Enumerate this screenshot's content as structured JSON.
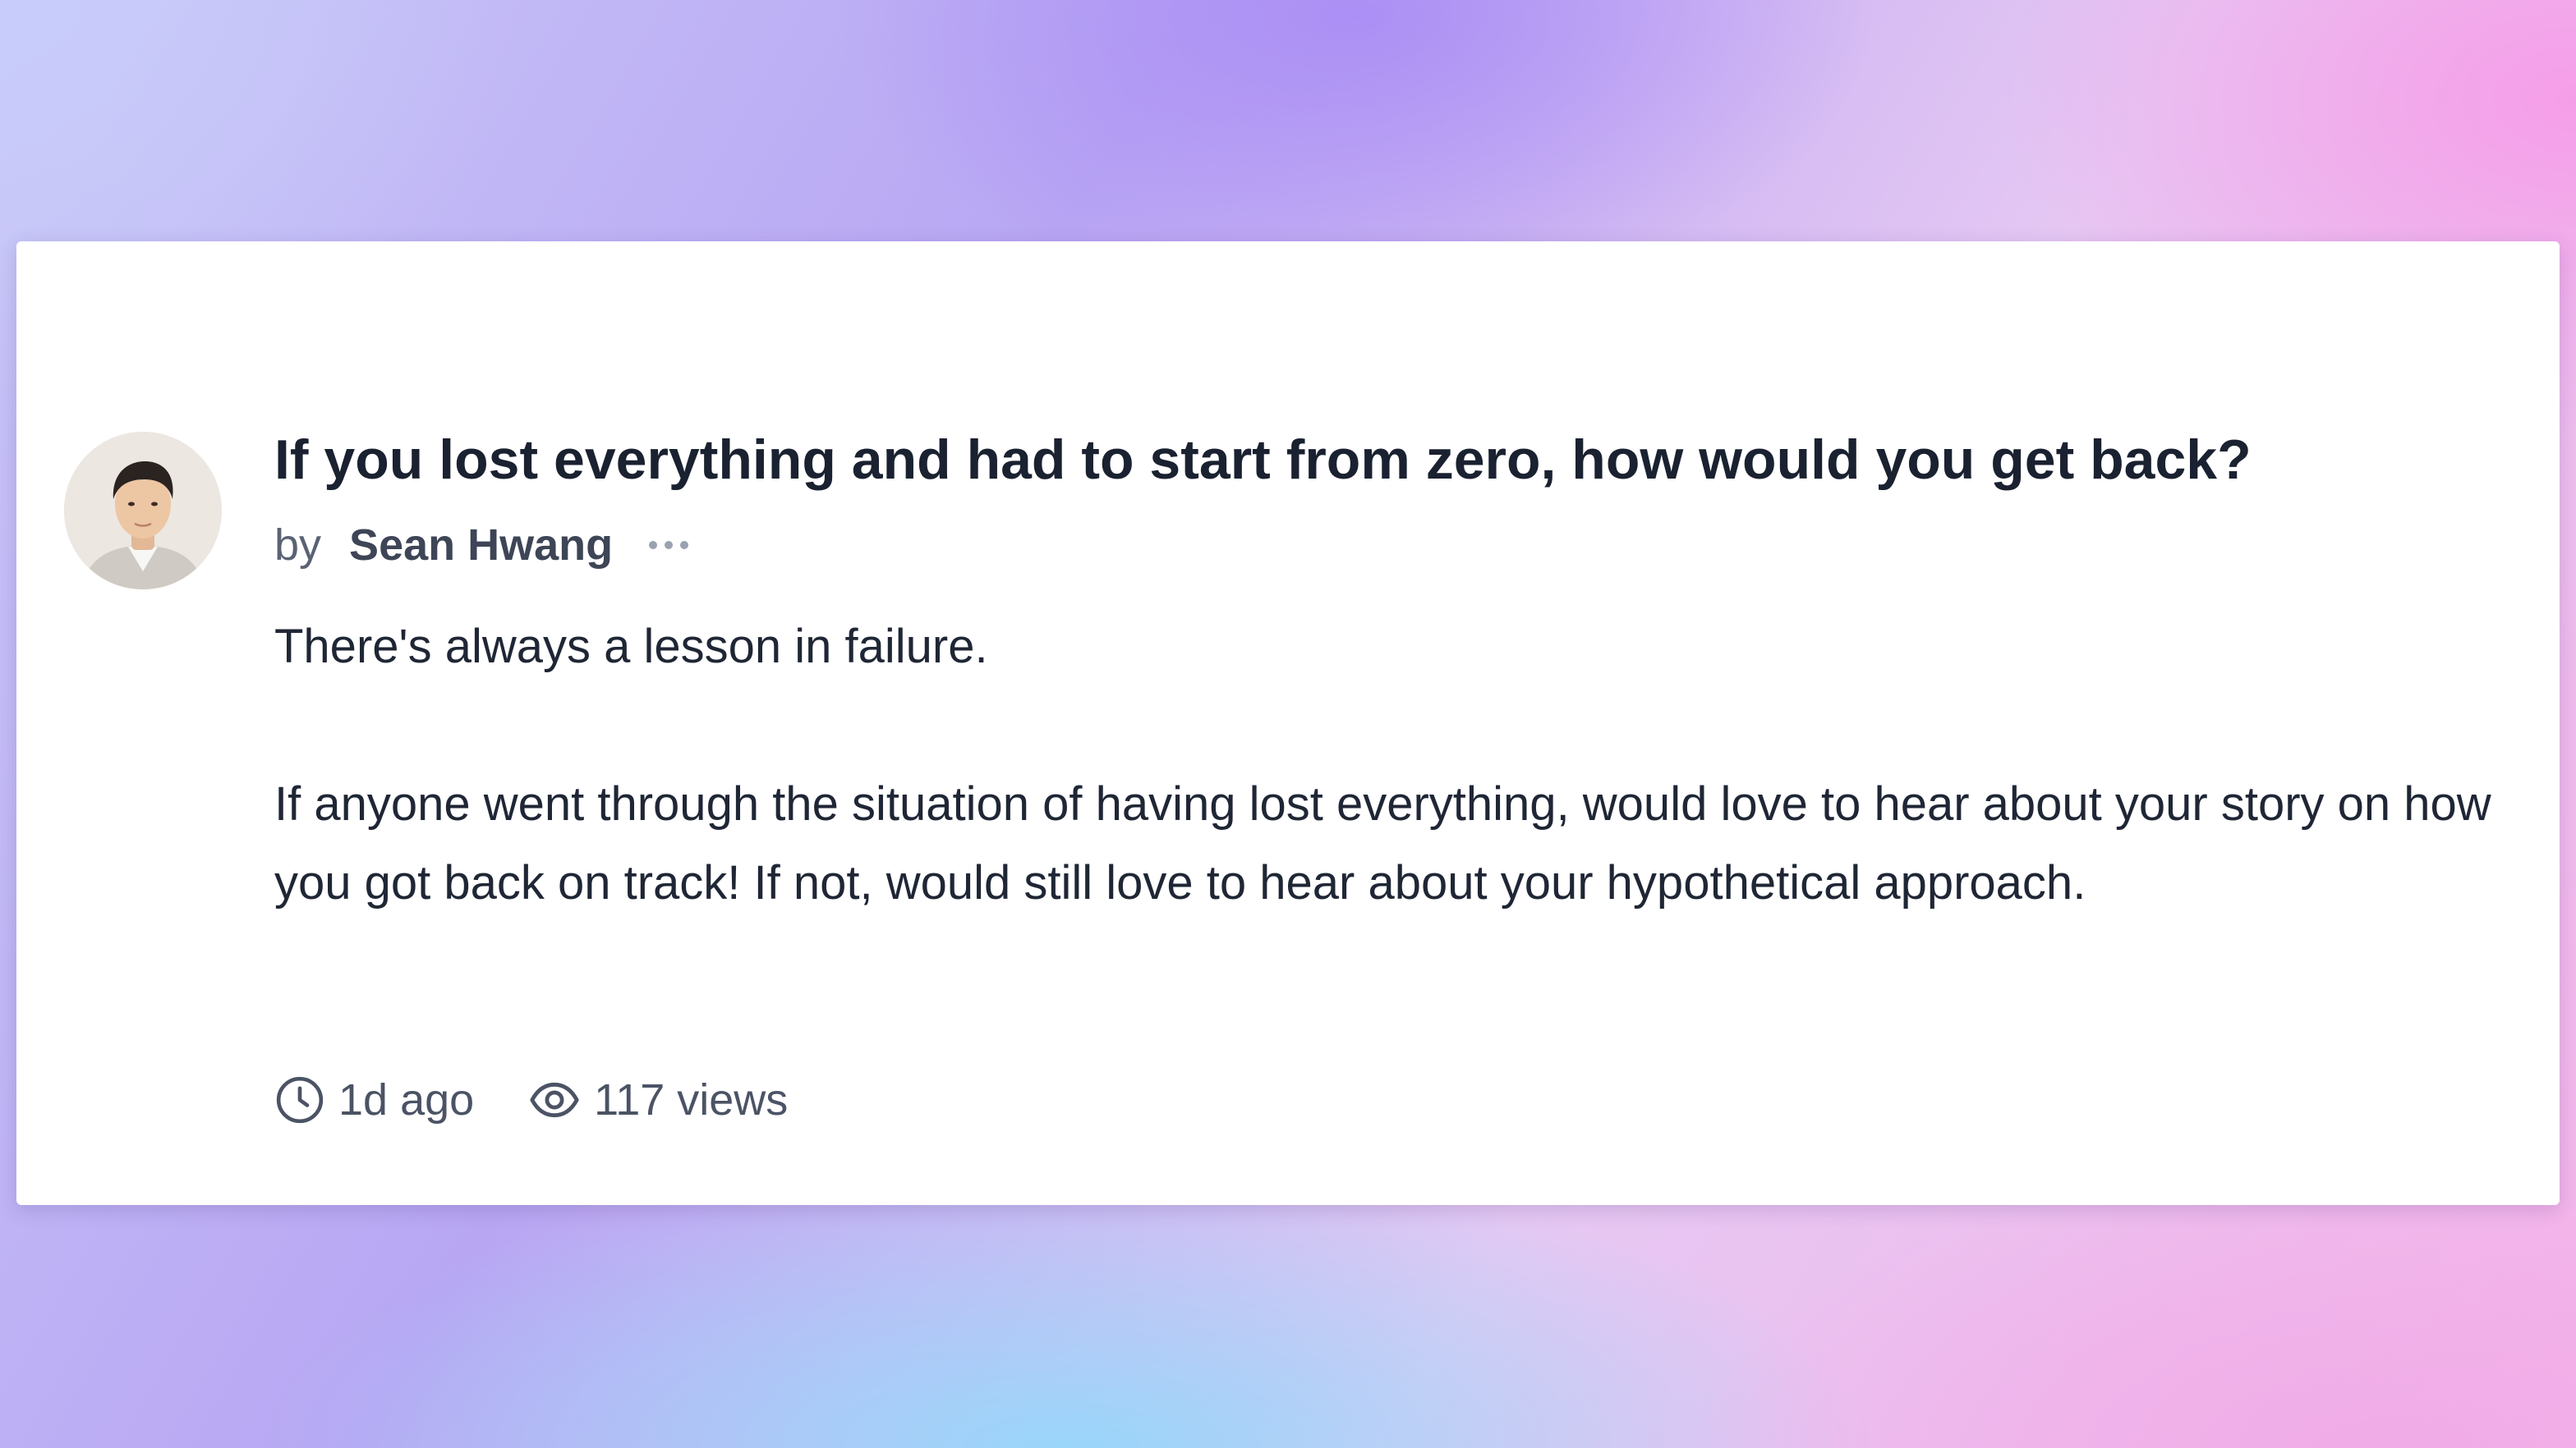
{
  "post": {
    "title": "If you lost everything and had to start from zero, how would you get back?",
    "by_label": "by",
    "author": "Sean Hwang",
    "body": {
      "line1": "There's always a lesson in failure.",
      "paragraph2": "If anyone went through the situation of having lost everything, would love to hear about your story on how you got back on track! If not, would still love to hear about your hypothetical approach."
    },
    "meta": {
      "time_ago": "1d ago",
      "views": "117 views"
    }
  },
  "icons": {
    "more": "more-horizontal-icon",
    "clock": "clock-icon",
    "eye": "eye-icon"
  },
  "colors": {
    "card_background": "#ffffff",
    "title_text": "#1a2130",
    "body_text": "#1f2635",
    "muted_text": "#4b5365"
  }
}
